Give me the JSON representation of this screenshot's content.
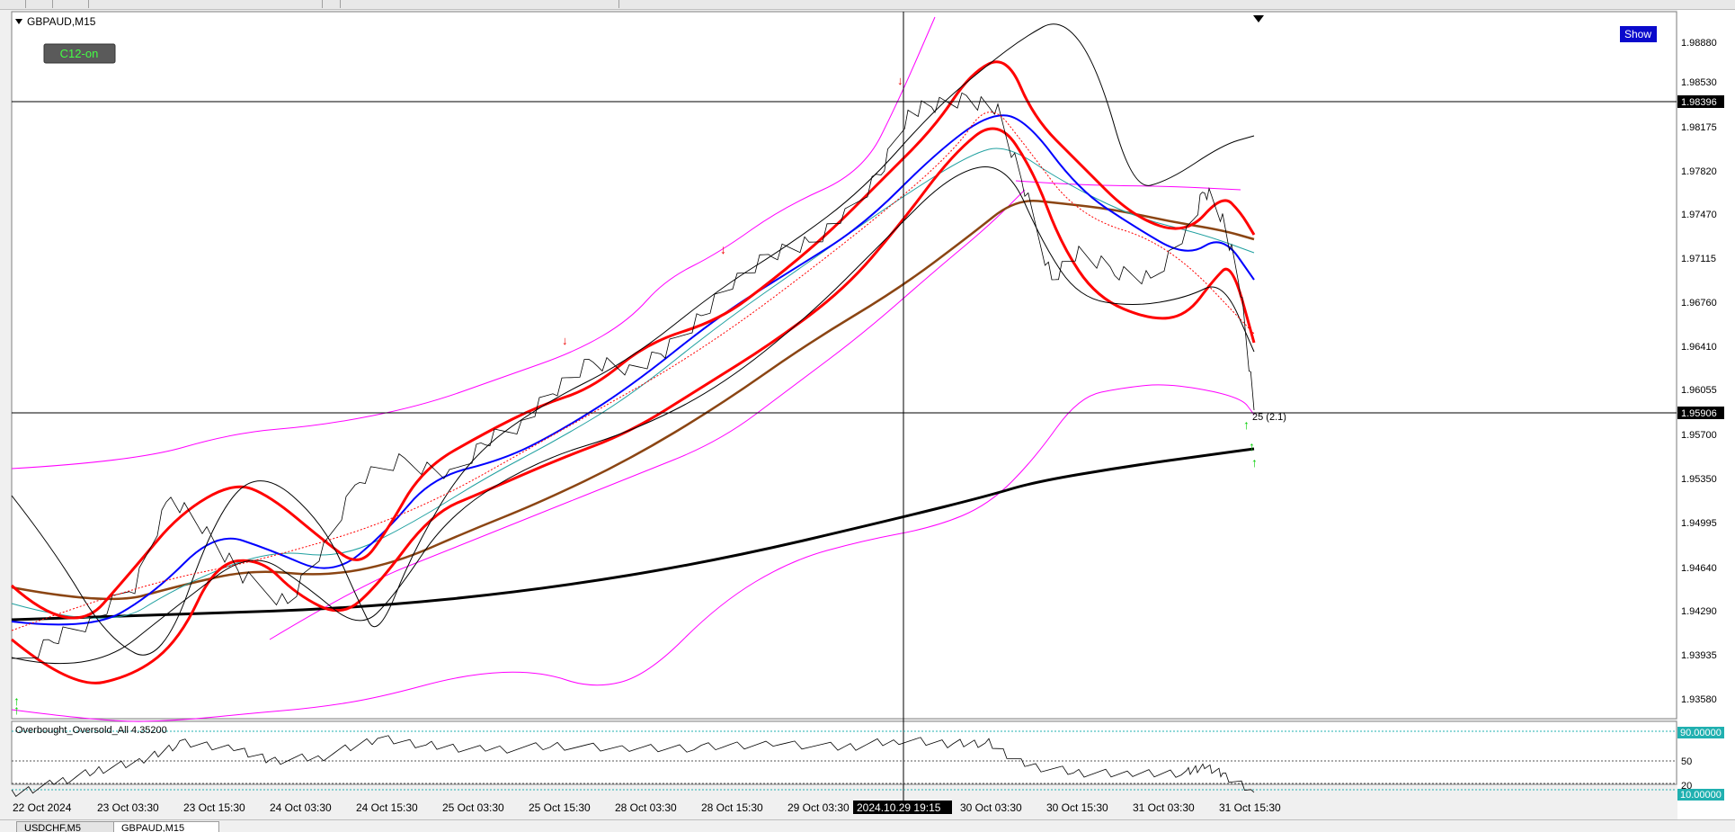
{
  "chart": {
    "symbol_title": "GBPAUD,M15",
    "button_c12": "C12-on",
    "button_show": "Show",
    "colors": {
      "bg": "#ffffff",
      "price": "#000000",
      "red_band": "#ff0000",
      "blue_ma": "#0000ff",
      "brown_ma": "#8b4513",
      "teal_ma": "#20a0a0",
      "magenta_band": "#ff00ff",
      "black_ma": "#000000",
      "oscillator_level": "#20b0b0",
      "level_label_bg": "#000000"
    },
    "price_axis": [
      "1.98880",
      "1.98530",
      "1.98175",
      "1.97820",
      "1.97470",
      "1.97115",
      "1.96760",
      "1.96410",
      "1.96055",
      "1.95700",
      "1.95350",
      "1.94995",
      "1.94640",
      "1.94290",
      "1.93935",
      "1.93580"
    ],
    "level_labels": [
      "1.98396",
      "1.95906"
    ],
    "arrow_annotation": "25 (2.1)",
    "time_axis": [
      "22 Oct 2024",
      "23 Oct 03:30",
      "23 Oct 15:30",
      "24 Oct 03:30",
      "24 Oct 15:30",
      "25 Oct 03:30",
      "25 Oct 15:30",
      "28 Oct 03:30",
      "28 Oct 15:30",
      "29 Oct 03:30",
      "30 Oct 03:30",
      "30 Oct 15:30",
      "31 Oct 03:30",
      "31 Oct 15:30"
    ],
    "crosshair_time": "2024.10.29 19:15"
  },
  "oscillator": {
    "title": "Overbought_Oversold_All 4.35200",
    "levels": [
      "90.00000",
      "50",
      "20",
      "10.00000"
    ]
  },
  "tabs": [
    "USDCHF,M5",
    "GBPAUD,M15"
  ]
}
